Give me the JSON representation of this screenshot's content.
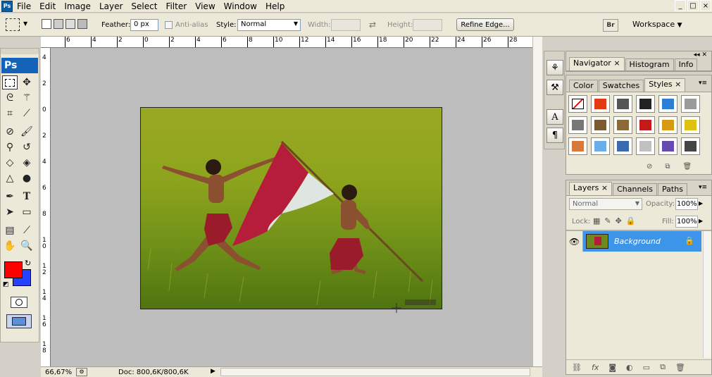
{
  "menu": {
    "items": [
      "File",
      "Edit",
      "Image",
      "Layer",
      "Select",
      "Filter",
      "View",
      "Window",
      "Help"
    ]
  },
  "window_controls": [
    "_",
    "□",
    "×"
  ],
  "options_bar": {
    "feather_label": "Feather:",
    "feather_value": "0 px",
    "anti_alias_label": "Anti-alias",
    "style_label": "Style:",
    "style_value": "Normal",
    "width_label": "Width:",
    "height_label": "Height:",
    "refine_edge_label": "Refine Edge...",
    "bridge_label": "Br",
    "workspace_label": "Workspace"
  },
  "toolbox": {
    "badge": "Ps",
    "foreground_color": "#ff0000",
    "background_color": "#2442ff"
  },
  "ruler": {
    "h_ticks": [
      "6",
      "4",
      "2",
      "0",
      "2",
      "4",
      "6",
      "8",
      "10",
      "12",
      "14",
      "16",
      "18",
      "20",
      "22",
      "24",
      "26",
      "28"
    ],
    "v_ticks": [
      "4",
      "2",
      "0",
      "2",
      "4",
      "6",
      "8",
      "10",
      "12",
      "14",
      "16",
      "18"
    ]
  },
  "status": {
    "zoom": "66,67%",
    "doc": "Doc: 800,6K/800,6K"
  },
  "navigator_panel": {
    "tabs": [
      "Navigator",
      "Histogram",
      "Info"
    ]
  },
  "styles_panel": {
    "tabs": [
      "Color",
      "Swatches",
      "Styles"
    ],
    "styles": [
      {
        "name": "none-style",
        "color": "#ffffff"
      },
      {
        "name": "red-glow-style",
        "color": "#e23a12"
      },
      {
        "name": "dark-gray-style",
        "color": "#555555"
      },
      {
        "name": "black-button-style",
        "color": "#222222"
      },
      {
        "name": "blue-glass-style",
        "color": "#2a7fd4"
      },
      {
        "name": "gray-style",
        "color": "#9a9a9a"
      },
      {
        "name": "chrome-style",
        "color": "#777777"
      },
      {
        "name": "brown-style",
        "color": "#7a5a32"
      },
      {
        "name": "wood-style",
        "color": "#8a6a38"
      },
      {
        "name": "red-style",
        "color": "#c41a1a"
      },
      {
        "name": "rainbow-style",
        "color": "#d69a12"
      },
      {
        "name": "yellow-style",
        "color": "#e0c010"
      },
      {
        "name": "orange-style",
        "color": "#d8783a"
      },
      {
        "name": "light-blue-style",
        "color": "#6aaee8"
      },
      {
        "name": "sky-style",
        "color": "#3a6ab0"
      },
      {
        "name": "pattern-style",
        "color": "#c0c0c0"
      },
      {
        "name": "purple-style",
        "color": "#6a4ab0"
      },
      {
        "name": "charcoal-style",
        "color": "#444444"
      }
    ]
  },
  "layers_panel": {
    "tabs": [
      "Layers",
      "Channels",
      "Paths"
    ],
    "blend_mode": "Normal",
    "opacity_label": "Opacity:",
    "opacity_value": "100%",
    "lock_label": "Lock:",
    "fill_label": "Fill:",
    "fill_value": "100%",
    "layers": [
      {
        "name": "Background",
        "visible": true,
        "locked": true,
        "selected": true
      }
    ]
  }
}
